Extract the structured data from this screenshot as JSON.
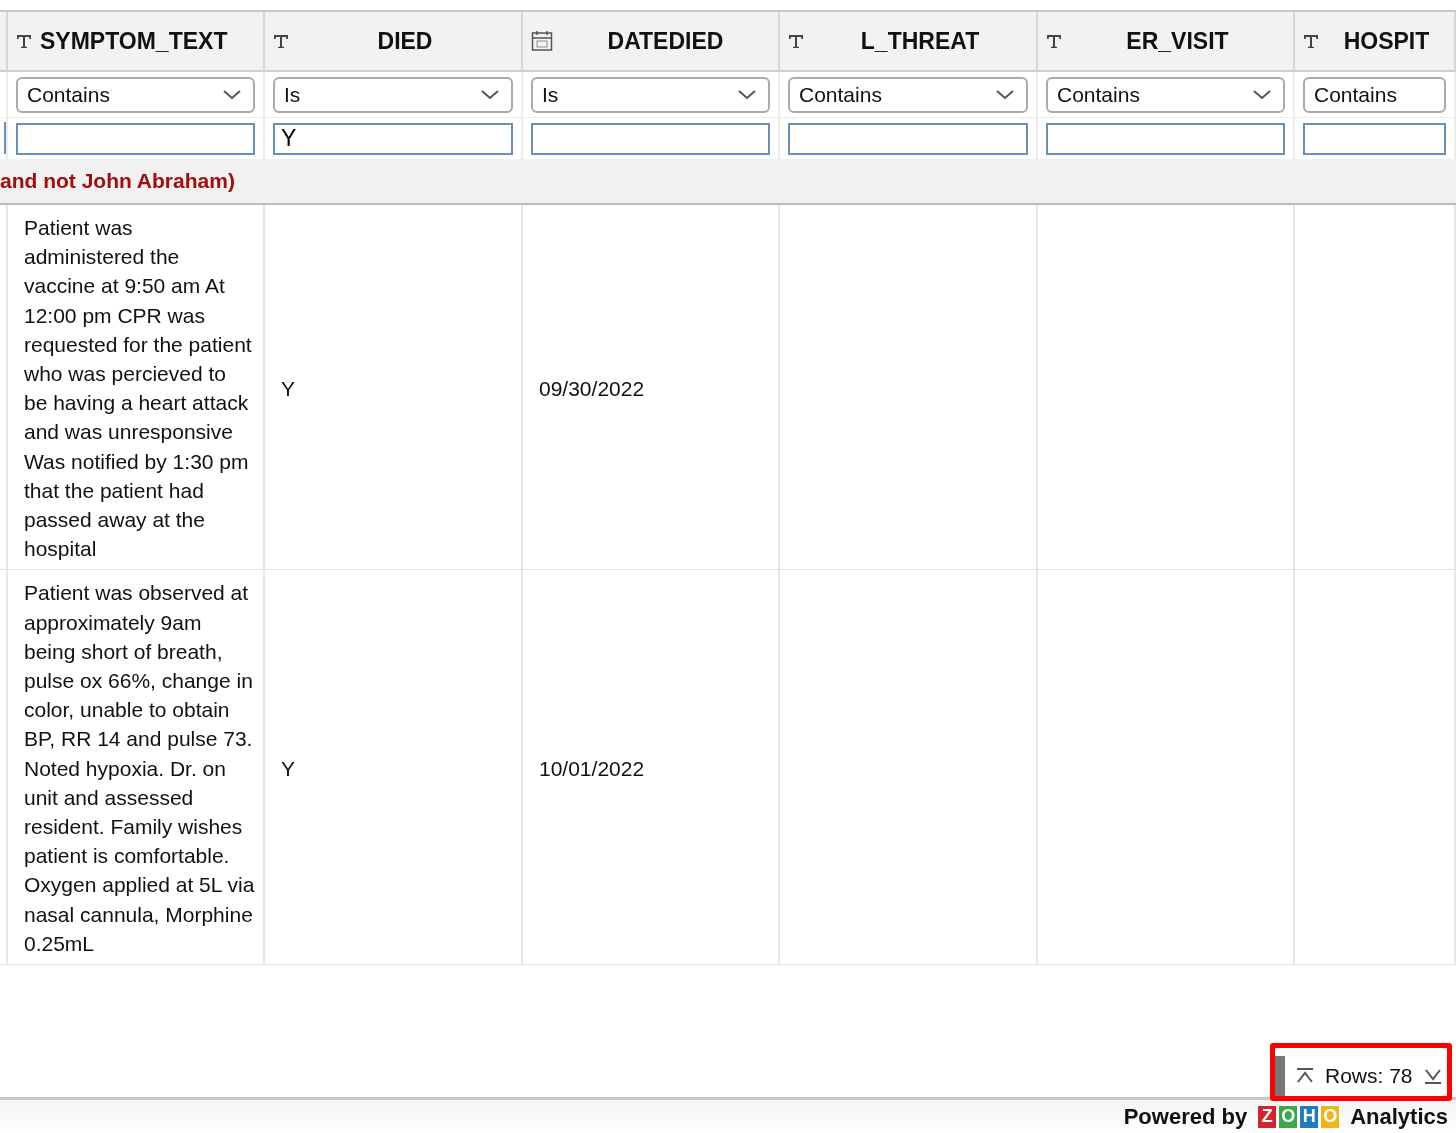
{
  "columns": [
    {
      "name": "SYMPTOM_TEXT",
      "kind": "text",
      "operator": "Contains"
    },
    {
      "name": "DIED",
      "kind": "text",
      "operator": "Is",
      "filter_value": "Y"
    },
    {
      "name": "DATEDIED",
      "kind": "date",
      "operator": "Is"
    },
    {
      "name": "L_THREAT",
      "kind": "text",
      "operator": "Contains"
    },
    {
      "name": "ER_VISIT",
      "kind": "text",
      "operator": "Contains"
    },
    {
      "name": "HOSPIT",
      "kind": "text",
      "operator": "Contains"
    }
  ],
  "group_banner": "and not John Abraham)",
  "rows": [
    {
      "symptom_text": "Patient was administered the vaccine at 9:50 am At 12:00 pm CPR was requested for the patient who was percieved to be having a heart attack and was unresponsive Was notified by 1:30 pm that the patient had passed away at the hospital",
      "died": "Y",
      "datedied": "09/30/2022"
    },
    {
      "symptom_text": "Patient was observed at approximately 9am being short of breath, pulse ox 66%, change in color, unable to obtain BP, RR 14 and pulse 73. Noted hypoxia. Dr. on unit and assessed resident. Family wishes patient is comfortable. Oxygen applied at 5L via nasal cannula, Morphine 0.25mL",
      "died": "Y",
      "datedied": "10/01/2022"
    }
  ],
  "row_counter": "Rows: 78",
  "footer": {
    "prefix": "Powered by",
    "logo_letters": [
      {
        "letter": "Z",
        "color": "#d4232b"
      },
      {
        "letter": "O",
        "color": "#3aa845"
      },
      {
        "letter": "H",
        "color": "#1f7ac1"
      },
      {
        "letter": "O",
        "color": "#f2b418"
      }
    ],
    "suffix": "Analytics"
  }
}
